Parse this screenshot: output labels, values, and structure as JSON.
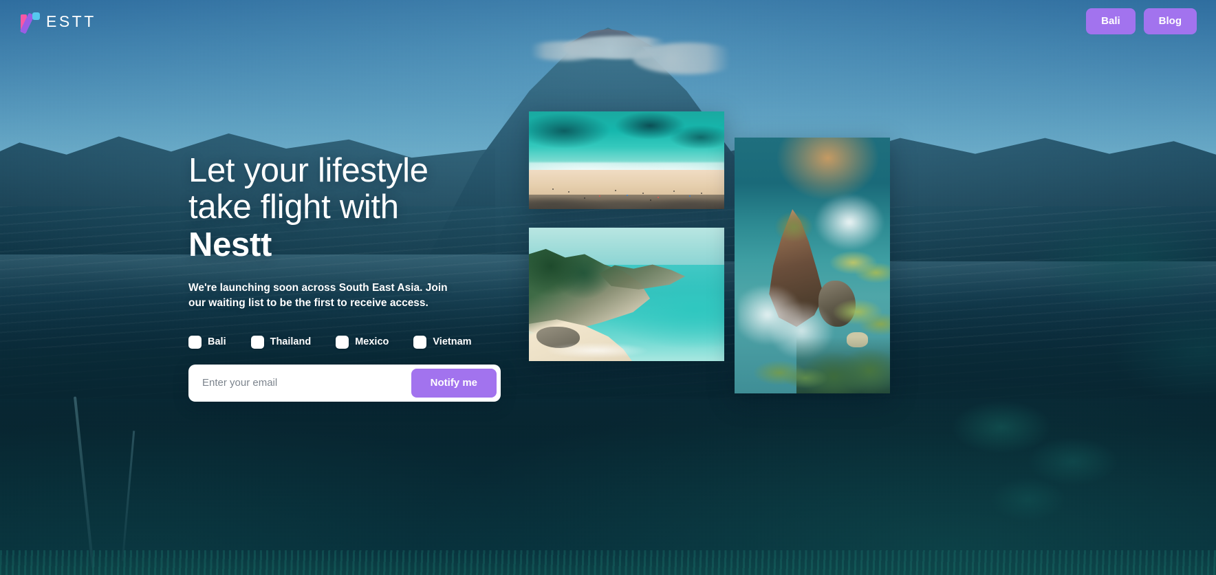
{
  "brand": {
    "logo_icon": "nestt-logo-icon",
    "name": "ESTT",
    "full_name": "Nestt",
    "colors": {
      "pink": "#F857A6",
      "purple": "#9B5DE5",
      "blue": "#56C8F0"
    }
  },
  "nav": {
    "buttons": [
      {
        "label": "Bali",
        "name": "nav-button-bali"
      },
      {
        "label": "Blog",
        "name": "nav-button-blog"
      }
    ],
    "accent_color": "#A273EE"
  },
  "hero": {
    "headline_line1": "Let your lifestyle",
    "headline_line2": "take flight with",
    "headline_brand": "Nestt",
    "subcopy": "We're launching soon across South East Asia. Join our waiting list to be the first to receive access."
  },
  "destinations": [
    {
      "label": "Bali",
      "checked": false
    },
    {
      "label": "Thailand",
      "checked": false
    },
    {
      "label": "Mexico",
      "checked": false
    },
    {
      "label": "Vietnam",
      "checked": false
    }
  ],
  "signup": {
    "email_placeholder": "Enter your email",
    "email_value": "",
    "submit_label": "Notify me"
  },
  "photos": [
    {
      "name": "photo-aerial-beach",
      "alt": "Aerial view of turquoise ocean meeting a sandy beach"
    },
    {
      "name": "photo-coastal-cliffs",
      "alt": "Tropical coastline with cliffs and turquoise bay"
    },
    {
      "name": "photo-sea-rock-palms",
      "alt": "Sea rock surrounded by surf with palm trees"
    }
  ],
  "background": {
    "scene": "volcano-landscape",
    "description": "Volcano peak with clouds above a hazy valley and dark tropical foreground"
  }
}
